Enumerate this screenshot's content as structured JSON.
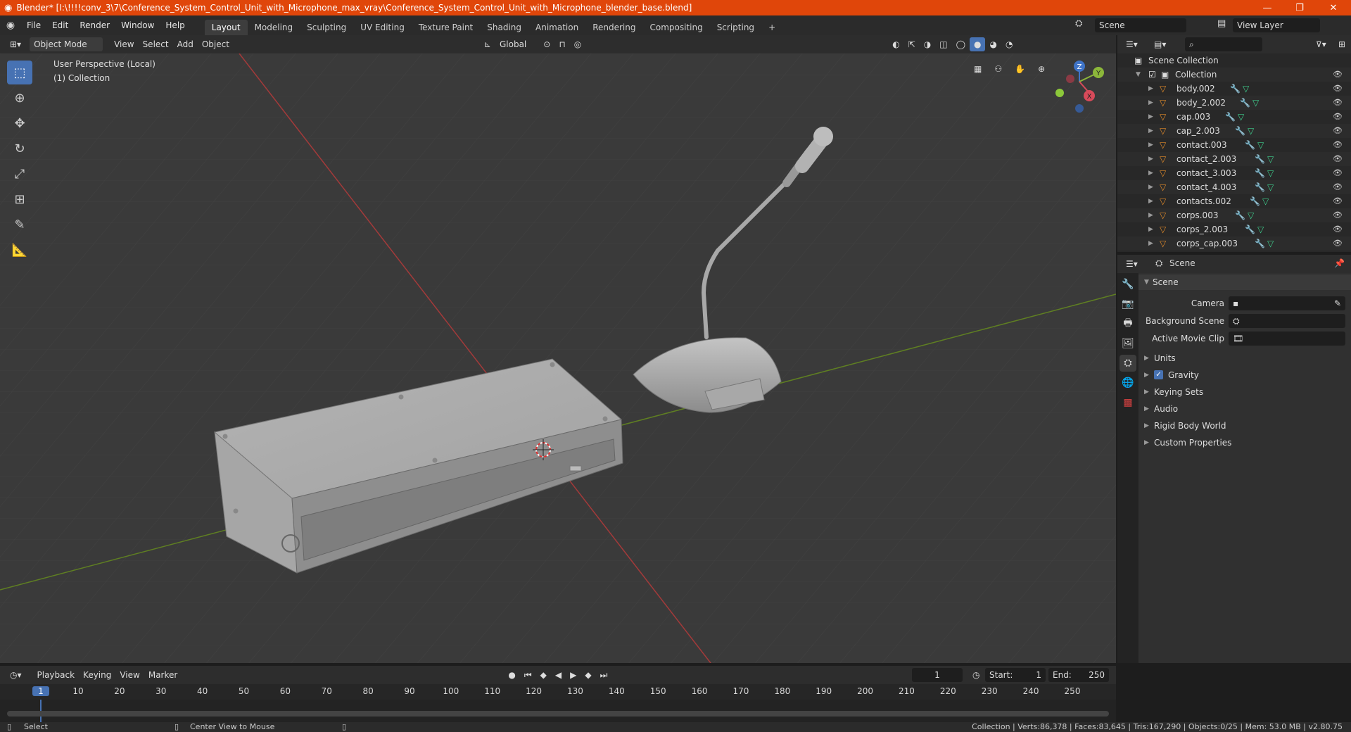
{
  "titlebar": {
    "title": "Blender* [I:\\!!!!conv_3\\7\\Conference_System_Control_Unit_with_Microphone_max_vray\\Conference_System_Control_Unit_with_Microphone_blender_base.blend]",
    "min": "—",
    "max": "❐",
    "close": "✕",
    "color": "#e0460a"
  },
  "menu": {
    "items": [
      "File",
      "Edit",
      "Render",
      "Window",
      "Help"
    ],
    "workspaces": [
      "Layout",
      "Modeling",
      "Sculpting",
      "UV Editing",
      "Texture Paint",
      "Shading",
      "Animation",
      "Rendering",
      "Compositing",
      "Scripting"
    ],
    "active_workspace": "Layout",
    "add_tab": "+",
    "scene": "Scene",
    "view_layer": "View Layer"
  },
  "viewport_header": {
    "mode": "Object Mode",
    "menus": [
      "View",
      "Select",
      "Add",
      "Object"
    ],
    "orientation": "Global"
  },
  "viewport": {
    "perspective": "User Perspective (Local)",
    "collection": "(1) Collection",
    "background": "#3a3a3a",
    "axis_x_color": "#c0392b",
    "axis_y_color": "#6b8e23",
    "gizmo": {
      "x": "X",
      "y": "Y",
      "z": "Z"
    }
  },
  "tools": [
    "select-box-icon",
    "cursor-icon",
    "move-icon",
    "rotate-icon",
    "scale-icon",
    "transform-icon",
    "annotate-icon",
    "measure-icon"
  ],
  "outliner": {
    "search_placeholder": "",
    "root": "Scene Collection",
    "collection": "Collection",
    "items": [
      "body.002",
      "body_2.002",
      "cap.003",
      "cap_2.003",
      "contact.003",
      "contact_2.003",
      "contact_3.003",
      "contact_4.003",
      "contacts.002",
      "corps.003",
      "corps_2.003",
      "corps_cap.003"
    ]
  },
  "properties": {
    "context": "Scene",
    "panel": "Scene",
    "fields": [
      {
        "label": "Camera",
        "value": ""
      },
      {
        "label": "Background Scene",
        "value": ""
      },
      {
        "label": "Active Movie Clip",
        "value": ""
      }
    ],
    "sections": [
      "Units",
      "Gravity",
      "Keying Sets",
      "Audio",
      "Rigid Body World",
      "Custom Properties"
    ],
    "gravity_checked": true
  },
  "timeline": {
    "menus": [
      "Playback",
      "Keying",
      "View",
      "Marker"
    ],
    "current_frame": "1",
    "start_label": "Start:",
    "start": "1",
    "end_label": "End:",
    "end": "250",
    "ticks": [
      "1",
      "10",
      "20",
      "30",
      "40",
      "50",
      "60",
      "70",
      "80",
      "90",
      "100",
      "110",
      "120",
      "130",
      "140",
      "150",
      "160",
      "170",
      "180",
      "190",
      "200",
      "210",
      "220",
      "230",
      "240",
      "250"
    ]
  },
  "status": {
    "left": "Select",
    "middle": "Center View to Mouse",
    "right": "Collection | Verts:86,378 | Faces:83,645 | Tris:167,290 | Objects:0/25 | Mem: 53.0 MB | v2.80.75"
  }
}
